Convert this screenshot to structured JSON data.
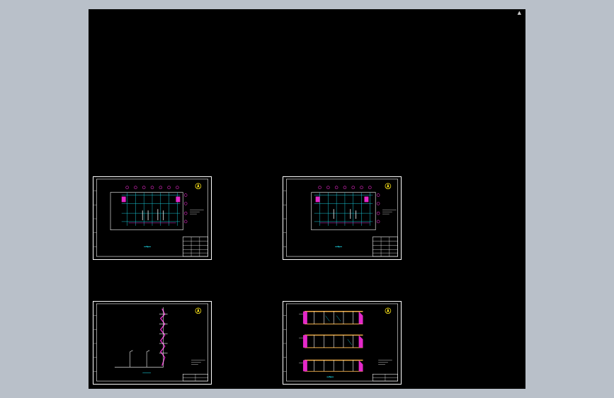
{
  "app": {
    "viewport_background": "#000000",
    "workspace_background": "#b9c0c9",
    "corner_glyph": "▲"
  },
  "sheets": [
    {
      "id": "plan-1",
      "type": "floor-plan"
    },
    {
      "id": "plan-2",
      "type": "floor-plan"
    },
    {
      "id": "section",
      "type": "section"
    },
    {
      "id": "elevations",
      "type": "elevation"
    }
  ],
  "colors": {
    "frame": "#ffffff",
    "grid_cyan": "#19c6d4",
    "magenta": "#e428c8",
    "yellow": "#ffe61a",
    "title_block": "#ffffff",
    "green": "#32e15a",
    "orange": "#f2b04a"
  }
}
